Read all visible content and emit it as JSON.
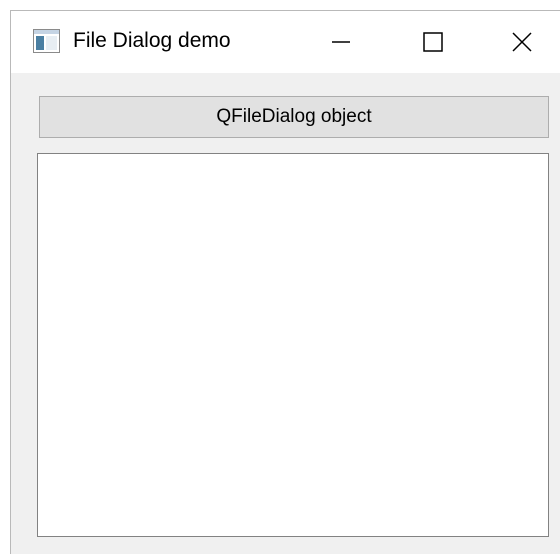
{
  "window": {
    "title": "File Dialog demo",
    "icon": "application-window-icon",
    "controls": [
      "minimize-icon",
      "maximize-icon",
      "close-icon"
    ]
  },
  "main": {
    "button_label": "QFileDialog object",
    "text_area_value": ""
  },
  "colors": {
    "window_background": "#f0f0f0",
    "titlebar_background": "#ffffff",
    "button_background": "#e1e1e1",
    "button_border": "#adadad",
    "text_area_border": "#828282"
  }
}
